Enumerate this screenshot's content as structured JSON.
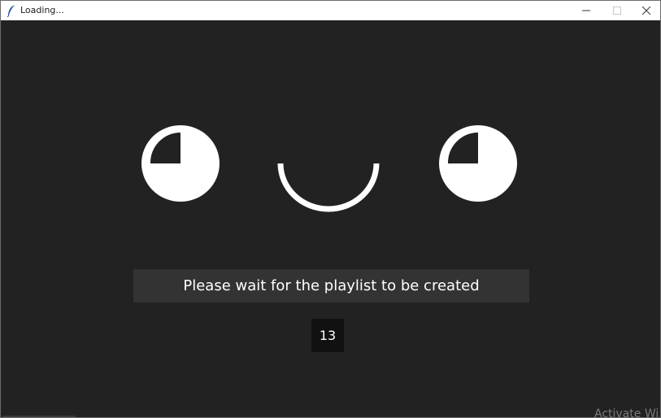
{
  "window": {
    "title": "Loading...",
    "controls": {
      "minimize_icon": "minimize-icon",
      "maximize_icon": "maximize-icon",
      "close_icon": "close-icon"
    }
  },
  "face": {
    "left_eye_icon": "eye-icon",
    "right_eye_icon": "eye-icon",
    "mouth_icon": "smile-icon"
  },
  "message": "Please wait for the playlist to be created",
  "counter": "13",
  "watermark": "Activate Wi",
  "colors": {
    "background": "#222222",
    "message_bg": "#333333",
    "counter_bg": "#111111",
    "foreground": "#ffffff"
  }
}
